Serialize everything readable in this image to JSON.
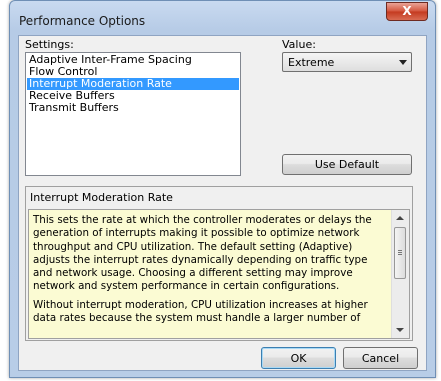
{
  "window": {
    "title": "Performance Options",
    "close_label": "X"
  },
  "settings": {
    "label": "Settings:",
    "items": [
      {
        "label": "Adaptive Inter-Frame Spacing",
        "selected": false
      },
      {
        "label": "Flow Control",
        "selected": false
      },
      {
        "label": "Interrupt Moderation Rate",
        "selected": true
      },
      {
        "label": "Receive Buffers",
        "selected": false
      },
      {
        "label": "Transmit Buffers",
        "selected": false
      }
    ]
  },
  "value": {
    "label": "Value:",
    "selected": "Extreme"
  },
  "use_default_label": "Use Default",
  "description": {
    "title": "Interrupt Moderation Rate",
    "paragraph1": "This sets the rate at which the controller moderates or delays the generation of interrupts making it possible to optimize network throughput and CPU utilization. The default setting (Adaptive) adjusts the interrupt rates dynamically depending on traffic type and network usage. Choosing a different setting may improve network and system performance in certain configurations.",
    "paragraph2": "Without interrupt moderation, CPU utilization increases at higher data rates because the system must handle a larger number of"
  },
  "buttons": {
    "ok": "OK",
    "cancel": "Cancel"
  },
  "colors": {
    "selection": "#3399ff",
    "description_background": "#fbfbd3",
    "close_button": "#c43a20"
  }
}
